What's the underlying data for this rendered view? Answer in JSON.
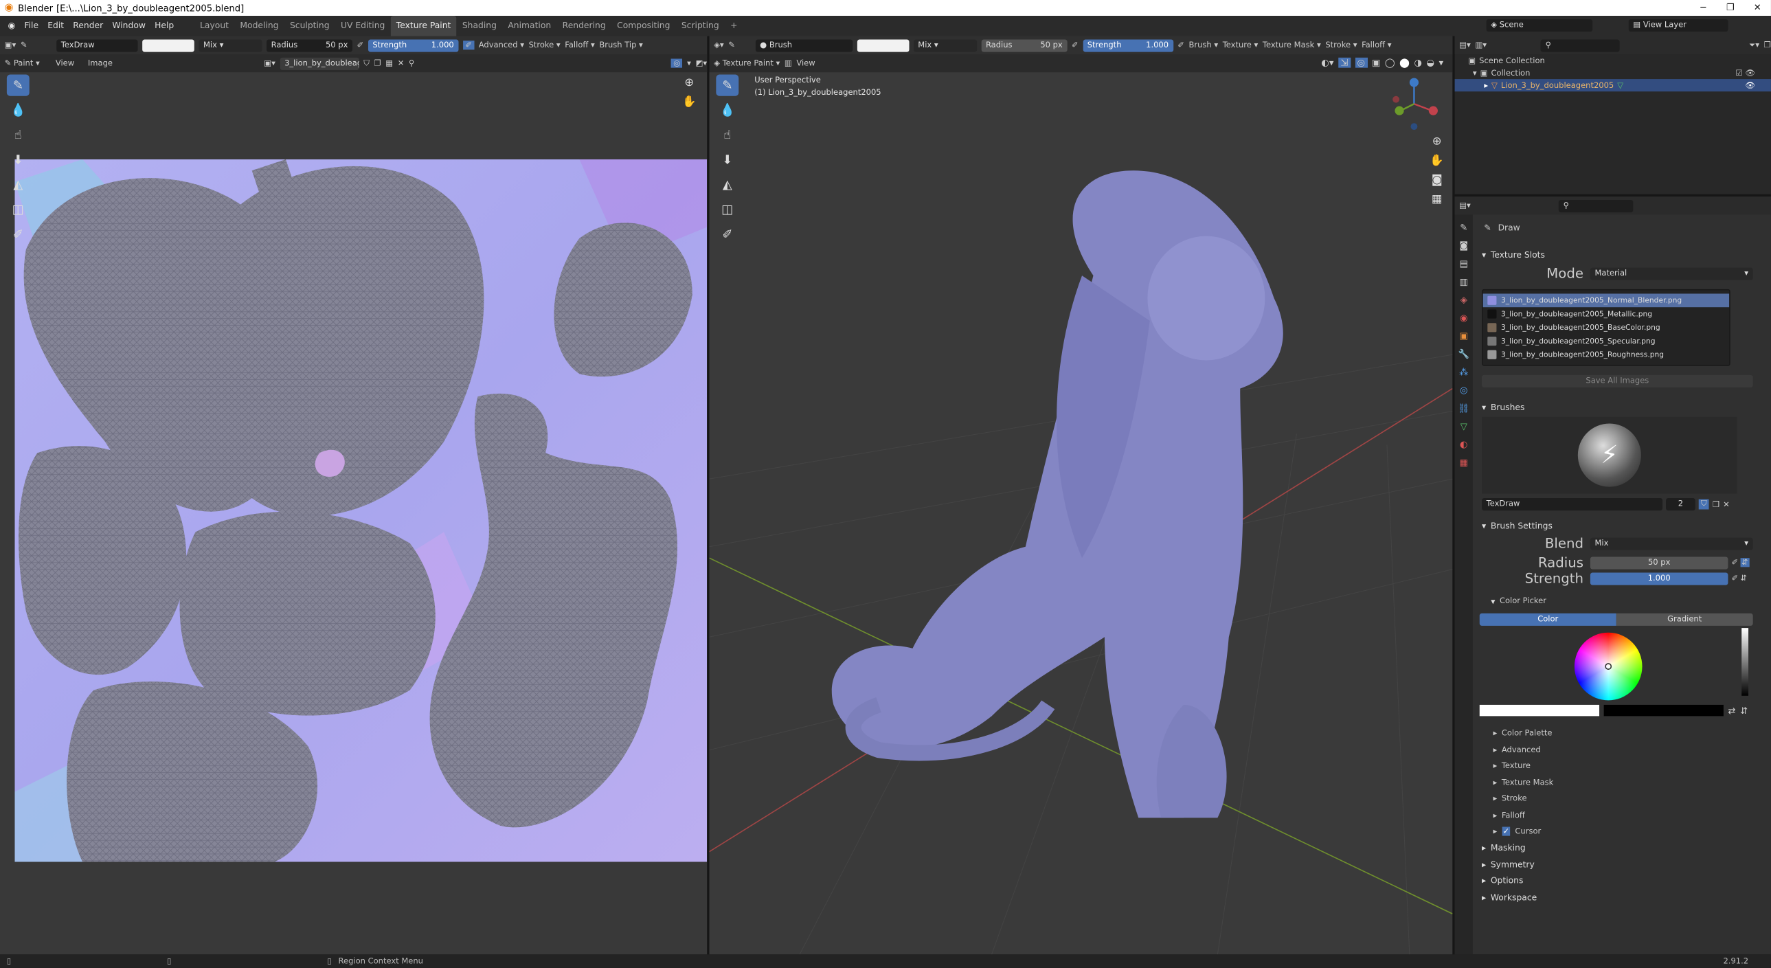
{
  "titlebar": {
    "app": "Blender",
    "path": "[E:\\...\\Lion_3_by_doubleagent2005.blend]",
    "controls": [
      "─",
      "❐",
      "✕"
    ]
  },
  "menu": {
    "items": [
      "File",
      "Edit",
      "Render",
      "Window",
      "Help"
    ]
  },
  "workspaces": {
    "tabs": [
      "Layout",
      "Modeling",
      "Sculpting",
      "UV Editing",
      "Texture Paint",
      "Shading",
      "Animation",
      "Rendering",
      "Compositing",
      "Scripting"
    ],
    "active": "Texture Paint",
    "add": "+"
  },
  "scene": {
    "label": "Scene",
    "view_layer": "View Layer"
  },
  "image_editor": {
    "header": {
      "brush": "TexDraw",
      "blend": "Mix",
      "radius_label": "Radius",
      "radius_value": "50 px",
      "strength_label": "Strength",
      "strength_value": "1.000",
      "advanced": "Advanced",
      "stroke": "Stroke",
      "falloff": "Falloff",
      "brush_tip": "Brush Tip"
    },
    "subheader": {
      "mode": "Paint",
      "view": "View",
      "image": "Image",
      "image_name": "3_lion_by_doubleag..."
    }
  },
  "viewport": {
    "header": {
      "brush": "Brush",
      "blend": "Mix",
      "radius_label": "Radius",
      "radius_value": "50 px",
      "strength_label": "Strength",
      "strength_value": "1.000",
      "texture": "Texture",
      "texture_mask": "Texture Mask",
      "stroke": "Stroke",
      "falloff": "Falloff"
    },
    "subheader": {
      "mode": "Texture Paint",
      "view": "View"
    },
    "overlay": {
      "perspective": "User Perspective",
      "object": "(1) Lion_3_by_doubleagent2005"
    },
    "brush_name": "TexDraw"
  },
  "outliner": {
    "items": [
      {
        "label": "Scene Collection"
      },
      {
        "label": "Collection"
      },
      {
        "label": "Lion_3_by_doubleagent2005"
      }
    ]
  },
  "properties": {
    "tool_title": "Draw",
    "texture_slots": {
      "title": "Texture Slots",
      "mode_label": "Mode",
      "mode_value": "Material",
      "slots": [
        "3_lion_by_doubleagent2005_Normal_Blender.png",
        "3_lion_by_doubleagent2005_Metallic.png",
        "3_lion_by_doubleagent2005_BaseColor.png",
        "3_lion_by_doubleagent2005_Specular.png",
        "3_lion_by_doubleagent2005_Roughness.png"
      ],
      "save_all": "Save All Images"
    },
    "brushes": {
      "title": "Brushes",
      "name": "TexDraw",
      "users": "2"
    },
    "brush_settings": {
      "title": "Brush Settings",
      "blend_label": "Blend",
      "blend_value": "Mix",
      "radius_label": "Radius",
      "radius_value": "50 px",
      "strength_label": "Strength",
      "strength_value": "1.000",
      "color_picker": "Color Picker",
      "color_tab": "Color",
      "gradient_tab": "Gradient"
    },
    "subpanels": [
      "Color Palette",
      "Advanced",
      "Texture",
      "Texture Mask",
      "Stroke",
      "Falloff",
      "Cursor"
    ],
    "sections": [
      "Masking",
      "Symmetry",
      "Options",
      "Workspace"
    ]
  },
  "statusbar": {
    "context": "Region Context Menu",
    "version": "2.91.2"
  },
  "colors": {
    "accent": "#4772b3",
    "uv_bg": "#a6a6f0",
    "mesh": "#8484aa"
  }
}
